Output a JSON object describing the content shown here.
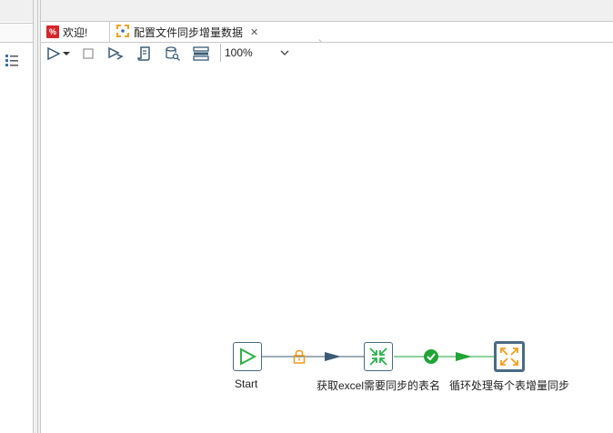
{
  "tabs": [
    {
      "label": "欢迎!",
      "icon": "welcome-icon",
      "active": false
    },
    {
      "label": "配置文件同步增量数据",
      "icon": "job-icon",
      "active": true
    }
  ],
  "toolbar": {
    "zoom_value": "100%",
    "buttons": [
      "run-icon",
      "dropdown-arrow-icon",
      "stop-icon",
      "debug-run-icon",
      "script-icon",
      "db-search-icon",
      "layout-icon"
    ]
  },
  "flow": {
    "nodes": [
      {
        "id": "start",
        "label": "Start"
      },
      {
        "id": "get-tables",
        "label": "获取excel需要同步的表名"
      },
      {
        "id": "loop-sync",
        "label": "循环处理每个表增量同步"
      }
    ]
  },
  "colors": {
    "start_green": "#2bb24c",
    "link_dark": "#3b5b75",
    "link_green": "#21a336",
    "lock_orange": "#f09a18",
    "loop_orange": "#f0a020",
    "node_border": "#4a6a85"
  }
}
